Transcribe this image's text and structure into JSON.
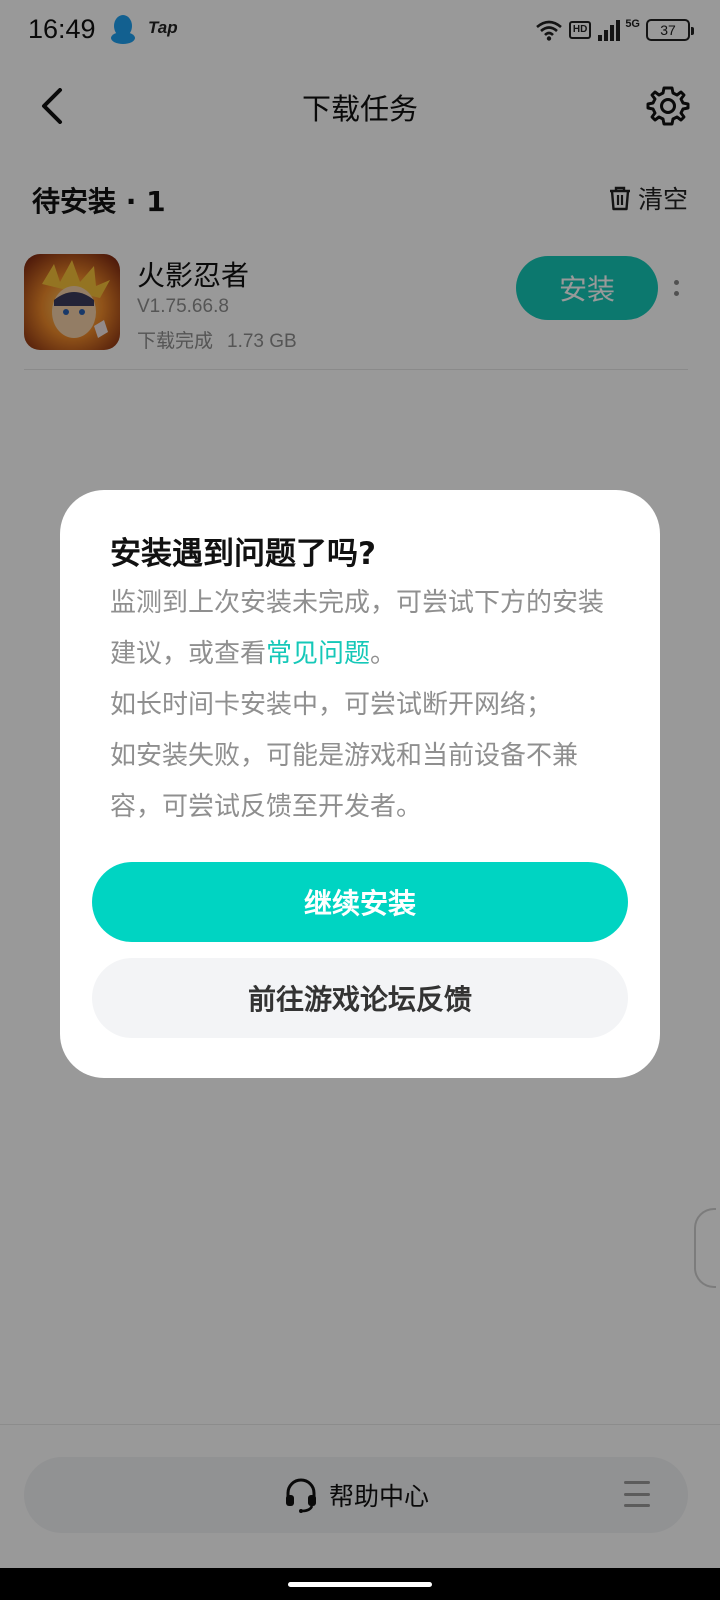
{
  "status_bar": {
    "time": "16:49",
    "tap_label": "Tap",
    "hd_label": "HD",
    "network_label": "5G",
    "battery": "37"
  },
  "header": {
    "title": "下载任务",
    "back_icon": "chevron-left-icon",
    "settings_icon": "gear-icon"
  },
  "section": {
    "title": "待安装 · 1",
    "clear_label": "清空",
    "clear_icon": "trash-icon"
  },
  "app": {
    "name": "火影忍者",
    "version": "V1.75.66.8",
    "status": "下载完成",
    "size": "1.73 GB",
    "install_label": "安装",
    "accent_color": "#15c8b8"
  },
  "dialog": {
    "title": "安装遇到问题了吗?",
    "body_before_link": "监测到上次安装未完成，可尝试下方的安装建议，或查看",
    "faq_link": "常见问题",
    "body_after_link": "。",
    "line_network": "如长时间卡安装中，可尝试断开网络；",
    "line_incompatible": "如安装失败，可能是游戏和当前设备不兼容，可尝试反馈至开发者。",
    "continue_label": "继续安装",
    "forum_label": "前往游戏论坛反馈",
    "primary_color": "#00d4c2"
  },
  "bottom": {
    "help_label": "帮助中心",
    "help_icon": "headset-icon",
    "menu_icon": "menu-icon"
  }
}
